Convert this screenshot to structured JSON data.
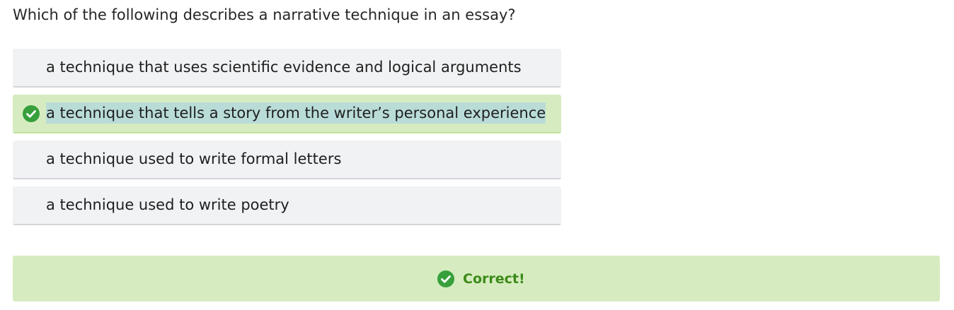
{
  "question": {
    "text": "Which of the following describes a narrative technique in an essay?"
  },
  "options": [
    {
      "label": "a technique that uses scientific evidence and logical arguments",
      "selected": false
    },
    {
      "label": "a technique that tells a story from the writer’s personal experience",
      "selected": true,
      "status": "correct"
    },
    {
      "label": "a technique used to write formal letters",
      "selected": false
    },
    {
      "label": "a technique used to write poetry",
      "selected": false
    }
  ],
  "feedback": {
    "text": "Correct!",
    "icon": "check-circle-icon"
  },
  "colors": {
    "correct_bg": "#d6ecc0",
    "correct_icon": "#37a03c",
    "correct_text": "#3c8a19",
    "option_bg": "#f1f2f4",
    "highlight": "#b9dcd9"
  }
}
